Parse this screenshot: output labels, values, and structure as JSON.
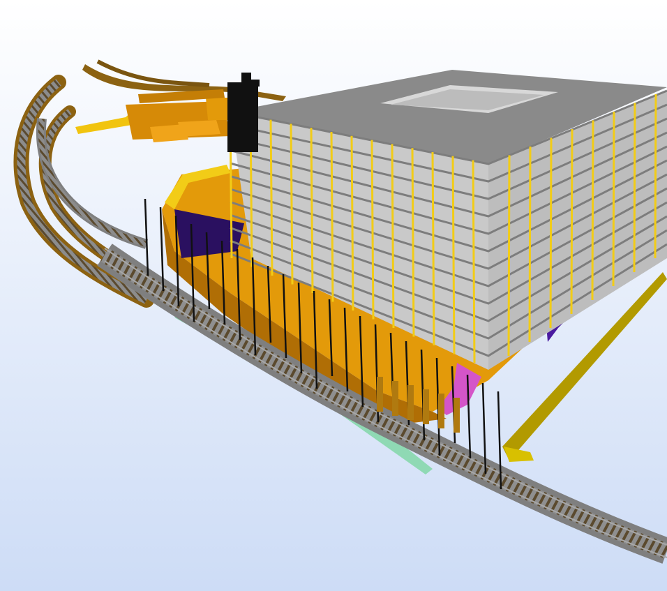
{
  "viewport": {
    "background_top": "#ffffff",
    "background_bottom": "#cddcf6"
  },
  "colors": {
    "concrete_top": "#8a8a8a",
    "concrete_face": "#c9c9c9",
    "concrete_edge": "#7d7d7d",
    "column_yellow": "#f2cc17",
    "excavation_orange": "#e39a0a",
    "excavation_dark": "#b06e05",
    "rail_gray": "#8f8f8f",
    "rail_tie": "#6b5a3a",
    "embankment_brown": "#8c6212",
    "pile_black": "#111111",
    "mint_slab": "#8fd9b4",
    "magenta_element": "#d455c8",
    "purple_element": "#4a1aa0",
    "olive_rail": "#b29a00"
  },
  "scene_objects": [
    "multi-storey-building",
    "building-columns",
    "excavation-pit",
    "railway-track-main",
    "railway-track-upper",
    "railway-track-far",
    "sheet-piles",
    "mint-slab",
    "magenta-element",
    "purple-element",
    "olive-rail",
    "crane-block",
    "storage-blocks",
    "road-ramp"
  ]
}
